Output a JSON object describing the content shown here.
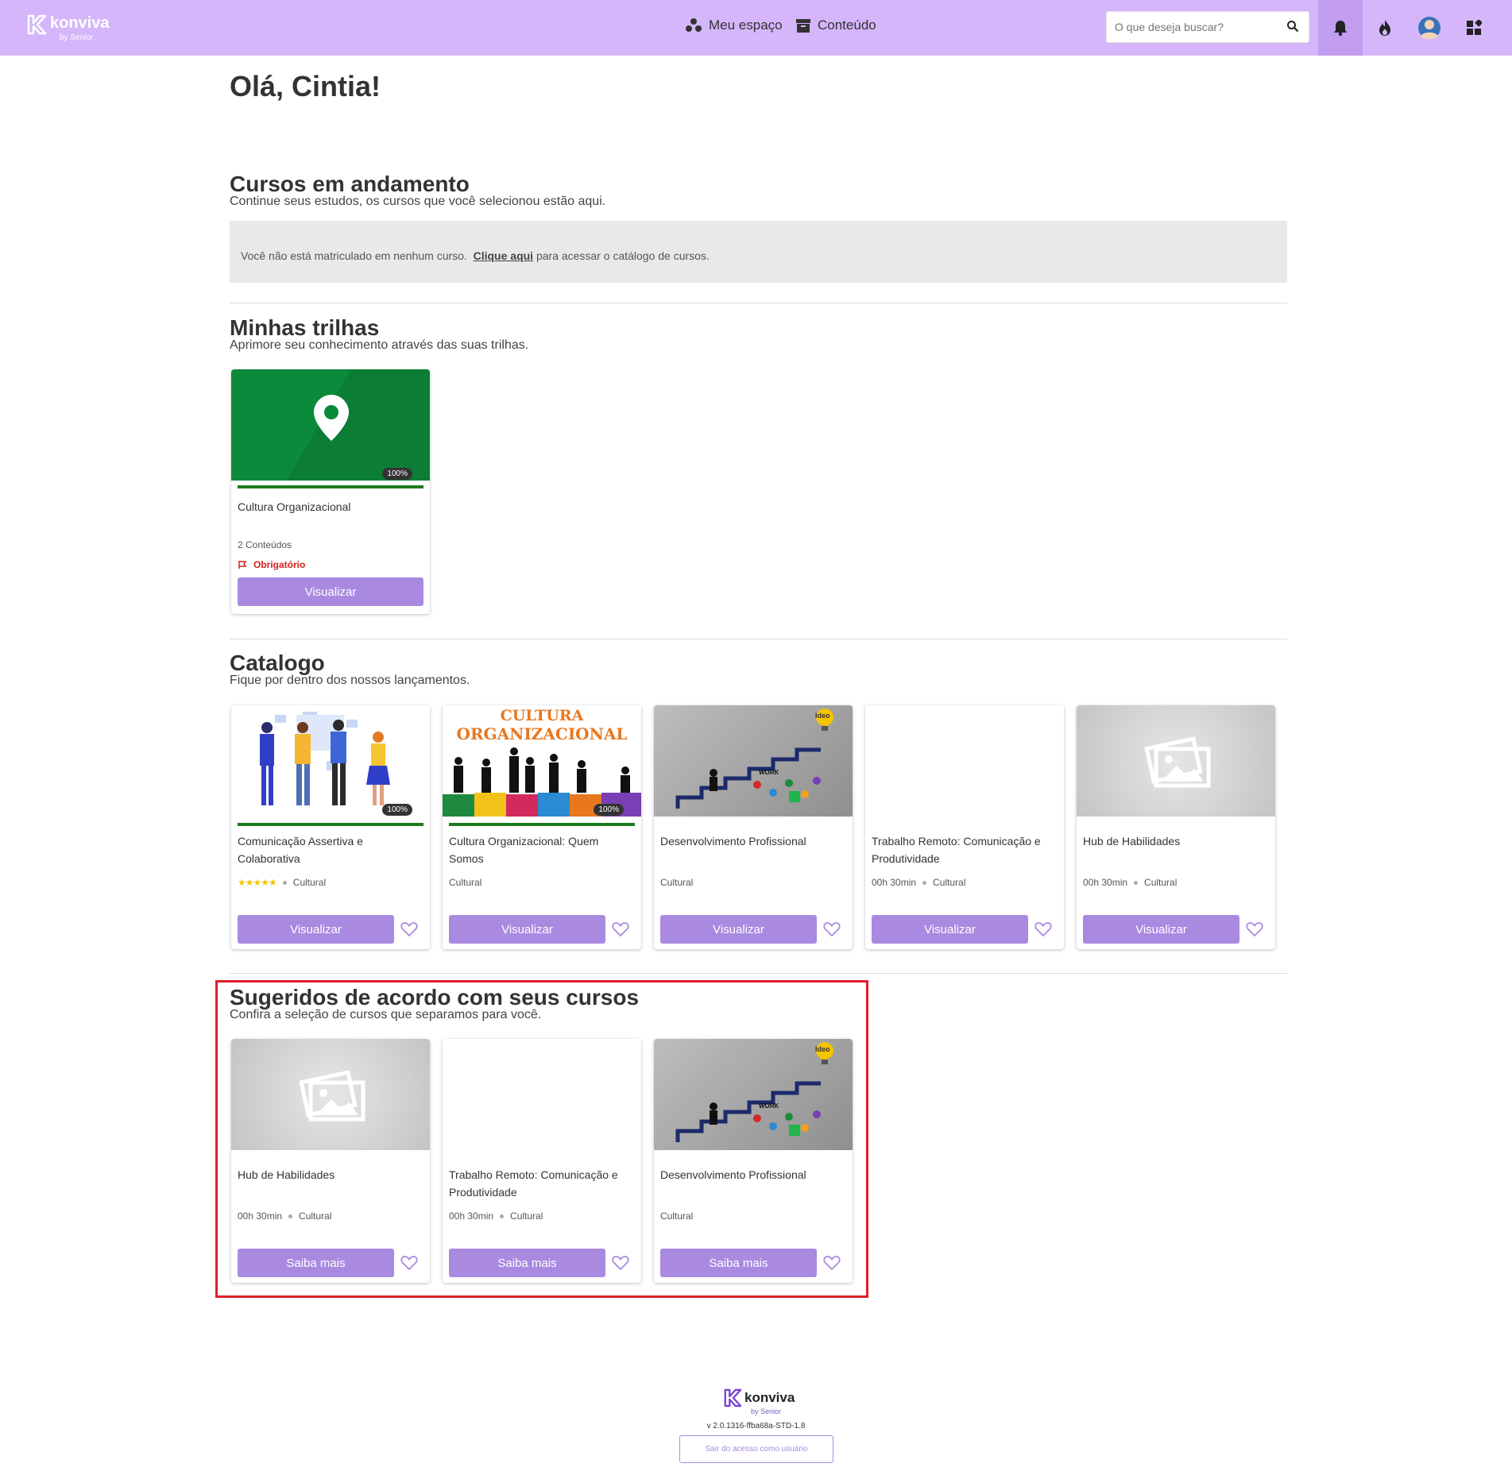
{
  "header": {
    "logo_text": "konviva",
    "logo_by": "by Senior",
    "nav": [
      {
        "label": "Meu espaço"
      },
      {
        "label": "Conteúdo"
      }
    ],
    "search_placeholder": "O que deseja buscar?"
  },
  "greeting": "Olá, Cintia!",
  "courses_in_progress": {
    "title": "Cursos em andamento",
    "subtitle": "Continue seus estudos, os cursos que você selecionou estão aqui.",
    "empty_text": "Você não está matriculado em nenhum curso.",
    "empty_link": "Clique aqui",
    "empty_suffix": "para acessar o catálogo de cursos."
  },
  "trails": {
    "title": "Minhas trilhas",
    "subtitle": "Aprimore seu conhecimento através das suas trilhas.",
    "items": [
      {
        "name": "Cultura Organizacional",
        "progress": "100%",
        "progress_value": 100,
        "contents": "2 Conteúdos",
        "required": "Obrigatório",
        "button": "Visualizar"
      }
    ]
  },
  "catalog": {
    "title": "Catalogo",
    "subtitle": "Fique por dentro dos nossos lançamentos.",
    "items": [
      {
        "name": "Comunicação Assertiva e Colaborativa",
        "progress": "100%",
        "progress_value": 100,
        "rating": 5,
        "category": "Cultural",
        "button": "Visualizar"
      },
      {
        "name": "Cultura Organizacional: Quem Somos",
        "progress": "100%",
        "progress_value": 100,
        "thumb_text_1": "CULTURA",
        "thumb_text_2": "ORGANIZACIONAL",
        "category": "Cultural",
        "button": "Visualizar"
      },
      {
        "name": "Desenvolvimento Profissional",
        "thumb_text_1": "Ideo",
        "thumb_text_2": "WORK",
        "category": "Cultural",
        "button": "Visualizar"
      },
      {
        "name": "Trabalho Remoto: Comunicação e Produtividade",
        "duration": "00h 30min",
        "category": "Cultural",
        "button": "Visualizar"
      },
      {
        "name": "Hub de Habilidades",
        "duration": "00h 30min",
        "category": "Cultural",
        "button": "Visualizar"
      }
    ]
  },
  "suggested": {
    "title": "Sugeridos de acordo com seus cursos",
    "subtitle": "Confira a seleção de cursos que separamos para você.",
    "items": [
      {
        "name": "Hub de Habilidades",
        "duration": "00h 30min",
        "category": "Cultural",
        "button": "Saiba mais"
      },
      {
        "name": "Trabalho Remoto: Comunicação e Produtividade",
        "duration": "00h 30min",
        "category": "Cultural",
        "button": "Saiba mais"
      },
      {
        "name": "Desenvolvimento Profissional",
        "thumb_text_1": "Ideo",
        "thumb_text_2": "WORK",
        "category": "Cultural",
        "button": "Saiba mais"
      }
    ]
  },
  "footer": {
    "logo_text": "konviva",
    "logo_by": "by Senior",
    "version": "v 2.0.1316-ffba68a-STD-1.8",
    "exit_button": "Sair do acesso como usuário"
  },
  "colors": {
    "header_bg": "#d5b6fb",
    "button": "#a98ae0",
    "progress": "#1e7b1e",
    "required": "#d32020",
    "highlight": "#e0202a"
  }
}
